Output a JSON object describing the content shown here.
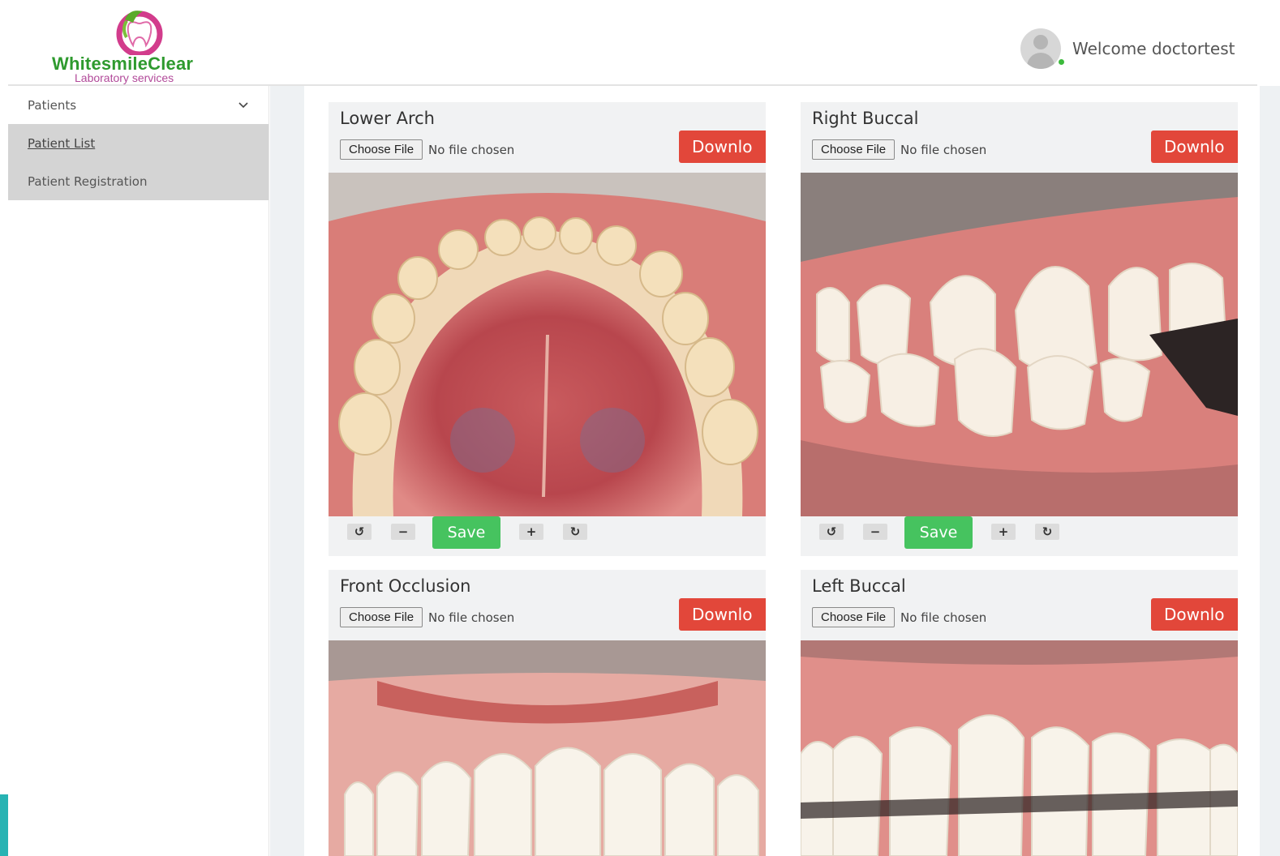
{
  "brand": {
    "name": "WhitesmileClear",
    "tagline": "Laboratory services"
  },
  "user": {
    "welcome": "Welcome doctortest"
  },
  "sidebar": {
    "section": "Patients",
    "items": [
      {
        "label": "Patient List",
        "active": true
      },
      {
        "label": "Patient Registration",
        "active": false
      }
    ]
  },
  "cards": [
    {
      "title": "Lower Arch",
      "choose_label": "Choose File",
      "file_status": "No file chosen",
      "download_label": "Downlo",
      "save_label": "Save"
    },
    {
      "title": "Right Buccal",
      "choose_label": "Choose File",
      "file_status": "No file chosen",
      "download_label": "Downlo",
      "save_label": "Save"
    },
    {
      "title": "Front Occlusion",
      "choose_label": "Choose File",
      "file_status": "No file chosen",
      "download_label": "Downlo"
    },
    {
      "title": "Left Buccal",
      "choose_label": "Choose File",
      "file_status": "No file chosen",
      "download_label": "Downlo"
    }
  ],
  "colors": {
    "download": "#e2473a",
    "save": "#46c35f",
    "brand_green": "#2e9a2e",
    "brand_pink": "#b24a9a"
  }
}
